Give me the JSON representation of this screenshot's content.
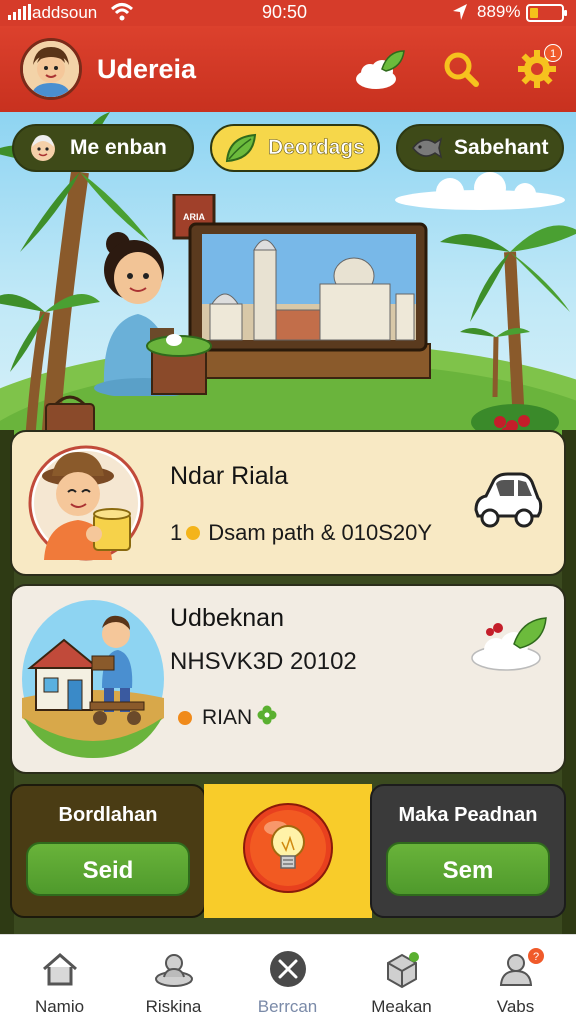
{
  "status_bar": {
    "carrier": "addsoun",
    "time": "90:50",
    "battery_text": "889%"
  },
  "header": {
    "title": "Udereia",
    "settings_badge": "1"
  },
  "chips": [
    {
      "label": "Me enban",
      "icon": "child-face-icon"
    },
    {
      "label": "Deordags",
      "icon": "leaf-icon"
    },
    {
      "label": "Sabehant",
      "icon": "fish-icon"
    }
  ],
  "scene": {
    "sign_text": "ARIA"
  },
  "cards": [
    {
      "title": "Ndar Riala",
      "meta_prefix": "1",
      "meta_text": "Dsam path & 010S20Y",
      "icon": "car-icon"
    },
    {
      "title": "Udbeknan",
      "subtitle": "NHSVK3D 20102",
      "status_text": "RIAN",
      "icon": "cloud-leaf-icon"
    }
  ],
  "actions": {
    "left": {
      "label": "Bordlahan",
      "button": "Seid"
    },
    "middle": {
      "icon": "lightbulb-icon"
    },
    "right": {
      "label": "Maka Peadnan",
      "button": "Sem"
    }
  },
  "nav": [
    {
      "label": "Namio",
      "icon": "home-icon"
    },
    {
      "label": "Riskina",
      "icon": "cloud-person-icon"
    },
    {
      "label": "Berrcan",
      "icon": "close-circle-icon",
      "active": true
    },
    {
      "label": "Meakan",
      "icon": "package-icon"
    },
    {
      "label": "Vabs",
      "icon": "user-icon",
      "badge": "?"
    }
  ]
}
